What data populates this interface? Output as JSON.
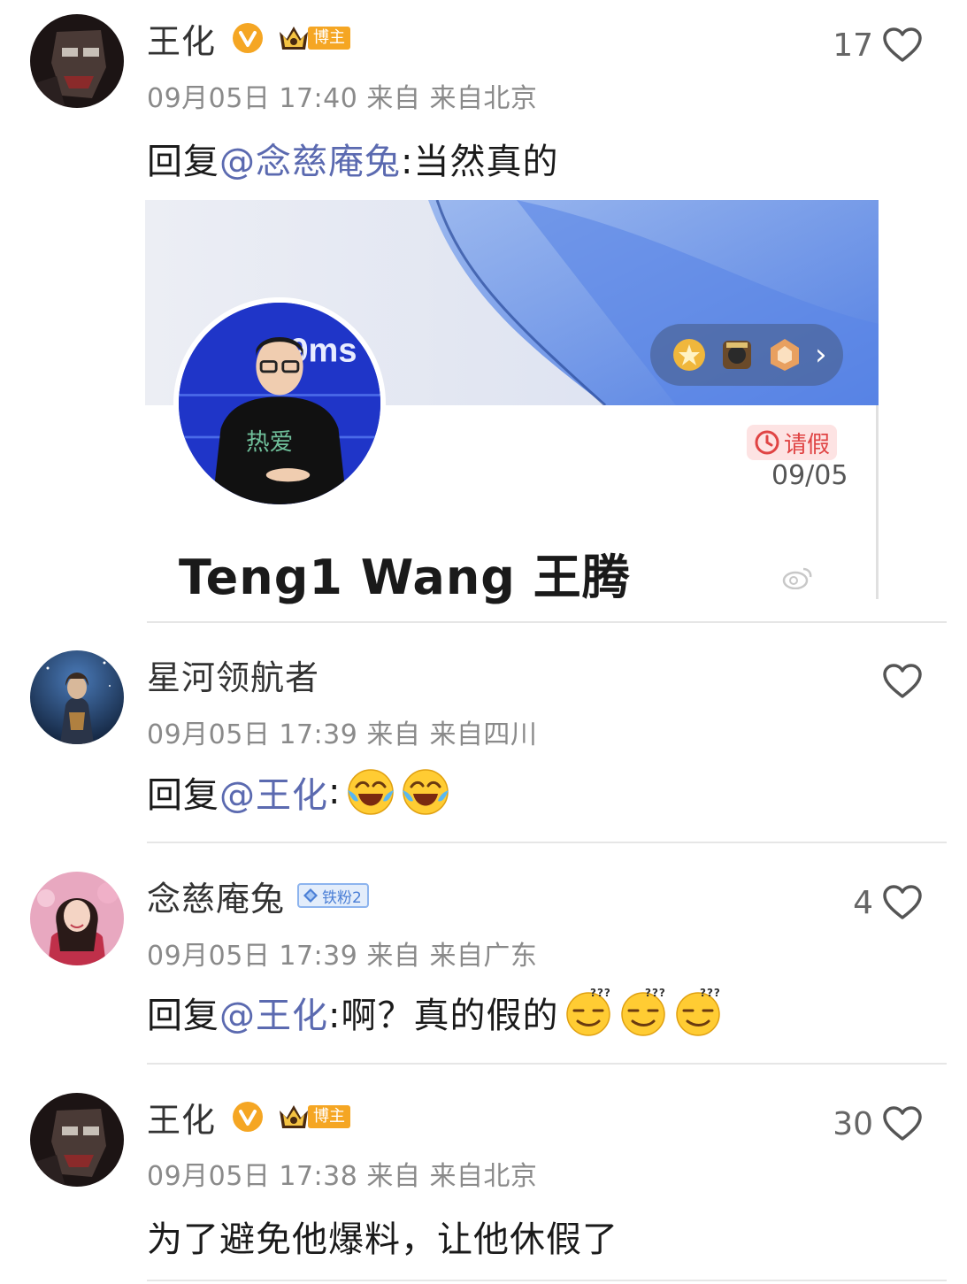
{
  "comments": [
    {
      "author": "王化",
      "verified": true,
      "host_badge": "博主",
      "time": "09月05日 17:40",
      "from_prefix": "来自",
      "location": "来自北京",
      "reply_prefix": "回复",
      "mention": "@念慈庵兔",
      "text": ":当然真的",
      "likes": "17"
    },
    {
      "author": "星河领航者",
      "time": "09月05日 17:39",
      "from_prefix": "来自",
      "location": "来自四川",
      "reply_prefix": "回复",
      "mention": "@王化",
      "text": ":",
      "emojis": [
        "laugh-cry-emoji",
        "laugh-cry-emoji"
      ],
      "likes": ""
    },
    {
      "author": "念慈庵兔",
      "fan_badge": "铁粉2",
      "time": "09月05日 17:39",
      "from_prefix": "来自",
      "location": "来自广东",
      "reply_prefix": "回复",
      "mention": "@王化",
      "text": ":啊？真的假的",
      "emojis": [
        "confused-emoji",
        "confused-emoji",
        "confused-emoji"
      ],
      "likes": "4"
    },
    {
      "author": "王化",
      "verified": true,
      "host_badge": "博主",
      "time": "09月05日 17:38",
      "from_prefix": "来自",
      "location": "来自北京",
      "text": "为了避免他爆料，让他休假了",
      "likes": "30"
    }
  ],
  "attached_image": {
    "profile_name": "Teng1 Wang 王腾",
    "leave_label": "请假",
    "leave_date": "09/05",
    "avatar_backdrop_text": "9ms",
    "shirt_text": "热爱"
  },
  "colors": {
    "mention": "#5b6ab0",
    "verified": "#f5a623",
    "fan_badge": "#4b7fd6",
    "leave_badge": "#e04444"
  }
}
